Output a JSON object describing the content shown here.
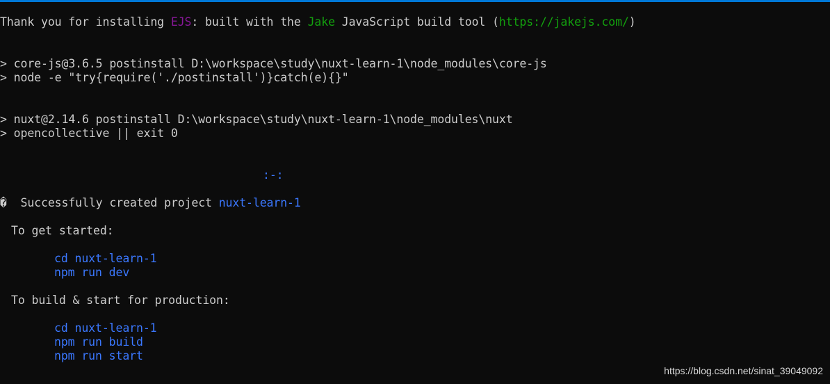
{
  "colors": {
    "background": "#0c0c0c",
    "foreground": "#cccccc",
    "purple": "#881798",
    "green": "#13a10e",
    "blue": "#3b78ff",
    "accent_bar": "#0078d7"
  },
  "terminal": {
    "ejs_line": {
      "part1": "Thank you for installing ",
      "ejs": "EJS",
      "part2": ": built with the ",
      "jake": "Jake",
      "part3": " JavaScript build tool (",
      "url": "https://jakejs.com/",
      "part4": ")"
    },
    "corejs": {
      "line1": "> core-js@3.6.5 postinstall D:\\workspace\\study\\nuxt-learn-1\\node_modules\\core-js",
      "line2": "> node -e \"try{require('./postinstall')}catch(e){}\""
    },
    "nuxt": {
      "line1": "> nuxt@2.14.6 postinstall D:\\workspace\\study\\nuxt-learn-1\\node_modules\\nuxt",
      "line2": "> opencollective || exit 0"
    },
    "logo": ":-:",
    "success": {
      "icon": "�",
      "text": "  Successfully created project ",
      "project": "nuxt-learn-1"
    },
    "get_started": {
      "heading": "To get started:",
      "commands": [
        "cd nuxt-learn-1",
        "npm run dev"
      ]
    },
    "production": {
      "heading": "To build & start for production:",
      "commands": [
        "cd nuxt-learn-1",
        "npm run build",
        "npm run start"
      ]
    }
  },
  "watermark": "https://blog.csdn.net/sinat_39049092"
}
